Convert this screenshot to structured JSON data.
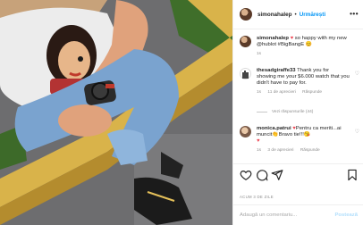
{
  "post": {
    "username": "simonahalep",
    "separator": "•",
    "follow_label": "Urmărești",
    "more_icon": "more-horizontal-icon",
    "more_label": "•••"
  },
  "comments": [
    {
      "username": "simonahalep",
      "text_prefix": " ",
      "heart_emoji": "♥",
      "text": " so happy with my new @hublot #BigBangE",
      "trailing_emoji": "😊",
      "time": "1s"
    },
    {
      "username": "thesadgiraffe33",
      "text": " Thank you for showing me your $6.000 watch that you didn't have to pay for.",
      "time": "1s",
      "likes": "11 de aprecieri",
      "reply_label": "Răspunde",
      "view_replies": "Vezi răspunsurile (44)"
    },
    {
      "username": "monica.patrui",
      "heart_emoji": "♥",
      "text_a": "Pentru ca meriti...ai muncit",
      "clap_emoji": "👏",
      "text_b": "Bravo tie!!!",
      "extra_emoji": "😘",
      "trailing_heart": "♥",
      "time": "1s",
      "likes": "3 de aprecieri",
      "reply_label": "Răspunde"
    }
  ],
  "comment_like_icon": "♡",
  "actions": {
    "like_icon": "heart-outline-icon",
    "comment_icon": "comment-bubble-icon",
    "share_icon": "paper-plane-icon",
    "save_icon": "bookmark-icon"
  },
  "date": "ACUM 3 DE ZILE",
  "add_comment": {
    "placeholder": "Adaugă un comentariu...",
    "post_label": "Postează"
  },
  "colors": {
    "link_blue": "#0095f6",
    "post_disabled": "#b2dffc",
    "secondary_text": "#8e8e8e",
    "heart_red": "#ed4956"
  }
}
